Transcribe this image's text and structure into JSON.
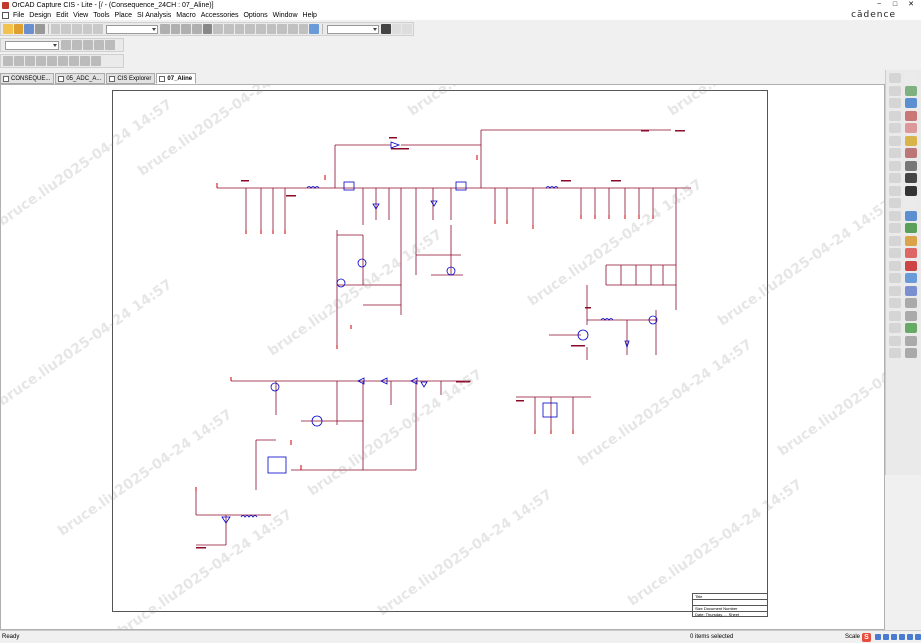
{
  "titlebar": {
    "title": "OrCAD Capture CIS - Lite - [/ - (Consequence_24CH : 07_Aline)]",
    "controls": [
      "−",
      "□",
      "✕"
    ]
  },
  "menubar": {
    "items": [
      "File",
      "Design",
      "Edit",
      "View",
      "Tools",
      "Place",
      "SI Analysis",
      "Macro",
      "Accessories",
      "Options",
      "Window",
      "Help"
    ],
    "brand": "cādence"
  },
  "tabs": [
    {
      "label": "CONSEQUE...",
      "active": false
    },
    {
      "label": "05_ADC_A...",
      "active": false
    },
    {
      "label": "CIS Explorer",
      "active": false
    },
    {
      "label": "07_Aline",
      "active": true
    }
  ],
  "toolbar": {
    "zoom_combo_value": "",
    "search_combo_value": ""
  },
  "watermark": {
    "text": "bruce.liu2025-04-24 14:57"
  },
  "title_block": {
    "rows": [
      "Title",
      "",
      "Size  Document Number",
      "Date:  Thursday, ...  Sheet"
    ]
  },
  "statusbar": {
    "ready": "Ready",
    "selection": "0 items selected",
    "scale_label": "Scale"
  },
  "colors": {
    "wire": "#8b0a2a",
    "power": "#cc0000",
    "component": "#0000c8",
    "frame": "#555555"
  }
}
